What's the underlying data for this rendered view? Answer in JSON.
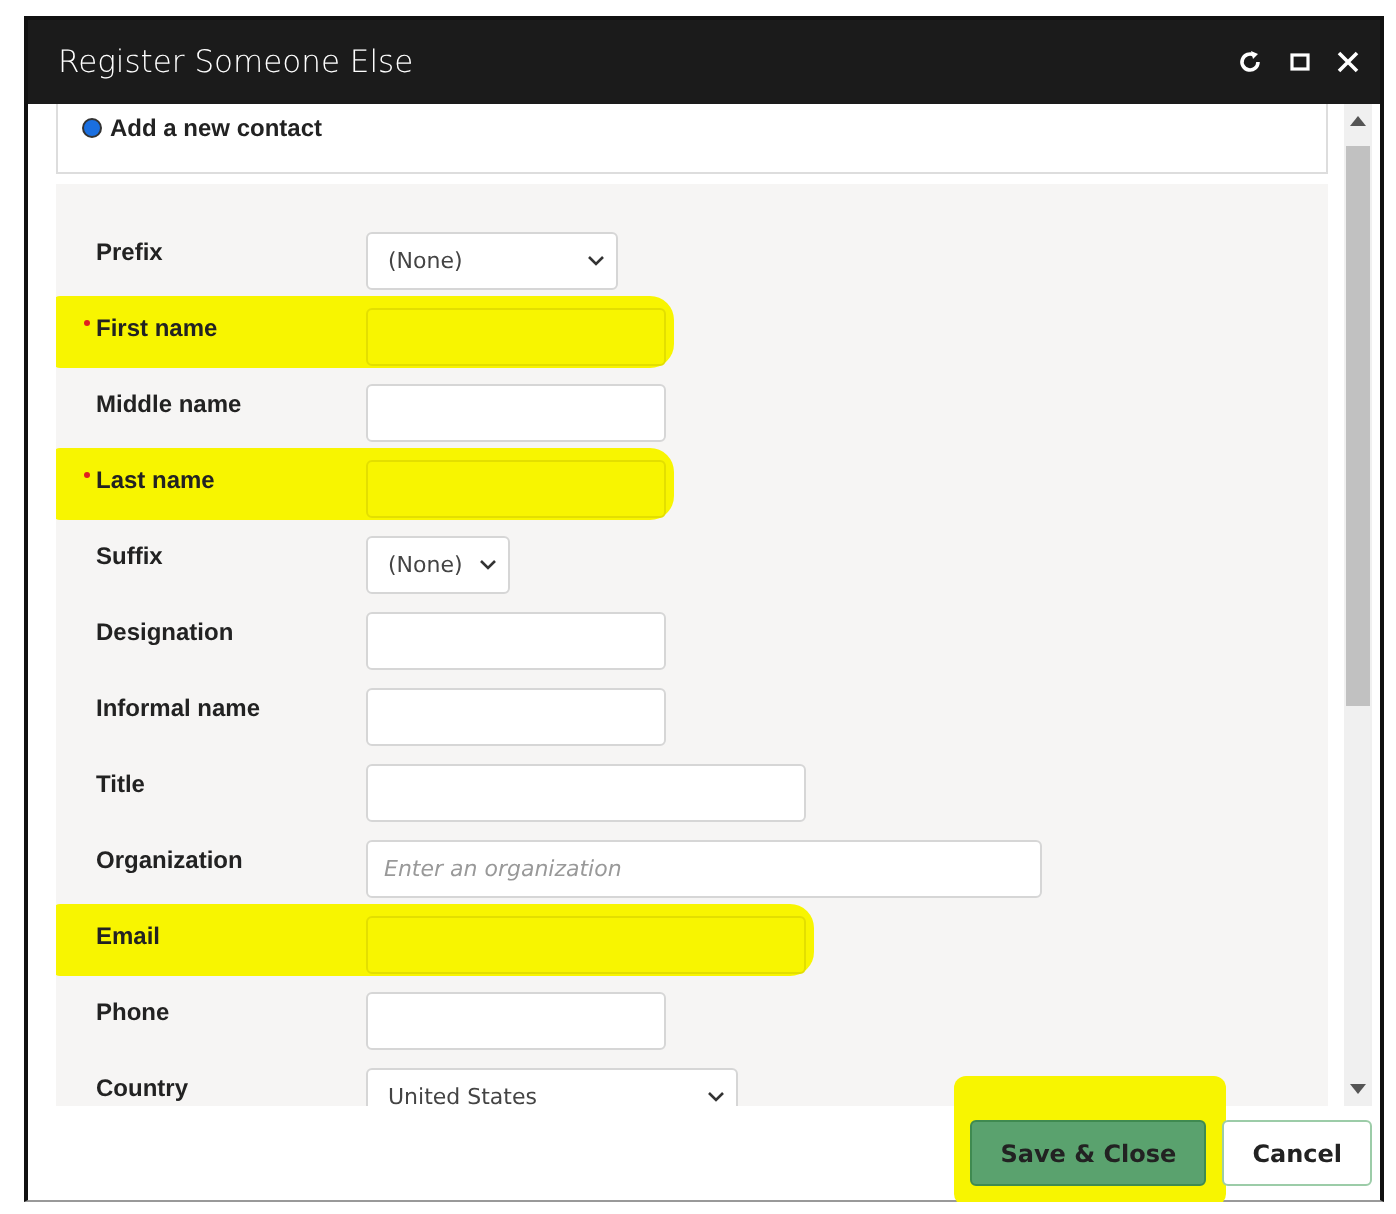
{
  "window": {
    "title": "Register Someone Else"
  },
  "contact_option": {
    "label": "Add a new contact",
    "selected": true
  },
  "fields": [
    {
      "label": "Prefix",
      "kind": "select",
      "value": "(None)",
      "required": false,
      "highlighted": false
    },
    {
      "label": "First name",
      "kind": "text",
      "required": true,
      "highlighted": true
    },
    {
      "label": "Middle name",
      "kind": "text",
      "required": false,
      "highlighted": false
    },
    {
      "label": "Last name",
      "kind": "text",
      "required": true,
      "highlighted": true
    },
    {
      "label": "Suffix",
      "kind": "select",
      "value": "(None)",
      "required": false,
      "highlighted": false
    },
    {
      "label": "Designation",
      "kind": "text",
      "required": false,
      "highlighted": false
    },
    {
      "label": "Informal name",
      "kind": "text",
      "required": false,
      "highlighted": false
    },
    {
      "label": "Title",
      "kind": "text",
      "required": false,
      "highlighted": false
    },
    {
      "label": "Organization",
      "kind": "text",
      "placeholder": "Enter an organization",
      "required": false,
      "highlighted": false
    },
    {
      "label": "Email",
      "kind": "text",
      "required": false,
      "highlighted": true
    },
    {
      "label": "Phone",
      "kind": "text",
      "required": false,
      "highlighted": false
    },
    {
      "label": "Country",
      "kind": "select",
      "value": "United States",
      "required": false,
      "highlighted": false
    }
  ],
  "buttons": [
    {
      "label": "Save & Close",
      "kind": "primary",
      "highlighted": true
    },
    {
      "label": "Cancel",
      "kind": "secondary",
      "highlighted": false
    }
  ]
}
